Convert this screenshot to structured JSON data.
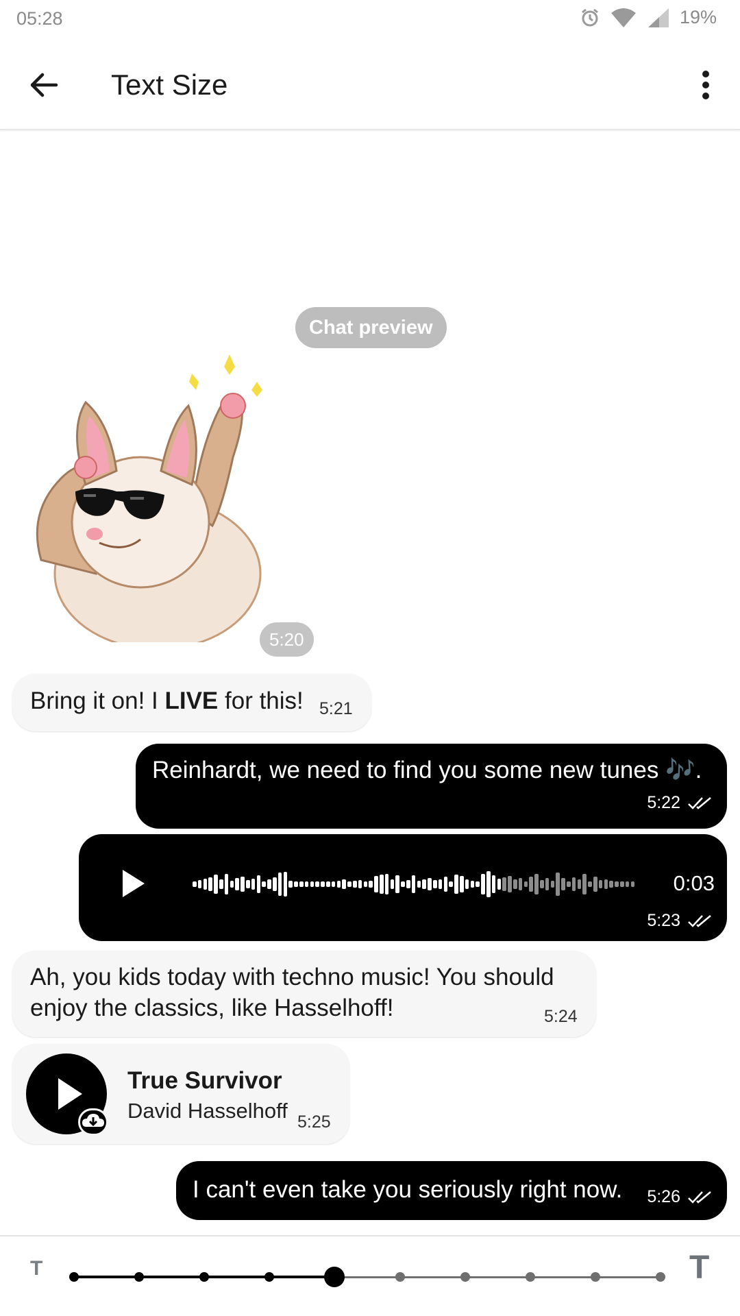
{
  "status_bar": {
    "time": "05:28",
    "battery": "19%"
  },
  "app_bar": {
    "title": "Text Size"
  },
  "chat": {
    "preview_label": "Chat preview",
    "sticker_time": "5:20",
    "messages": [
      {
        "text_before": "Bring it on! I ",
        "text_bold": "LIVE",
        "text_after": " for this!",
        "time": "5:21"
      },
      {
        "text": "Reinhardt, we need to find you some new tunes 🎶.",
        "time": "5:22"
      },
      {
        "voice_duration": "0:03",
        "time": "5:23"
      },
      {
        "text": "Ah, you kids today with techno music! You should enjoy the classics, like Hasselhoff!",
        "time": "5:24"
      },
      {
        "song_title": "True Survivor",
        "song_artist": "David Hasselhoff",
        "time": "5:25"
      },
      {
        "text": "I can't even take you seriously right now.",
        "time": "5:26"
      }
    ]
  },
  "text_size_slider": {
    "small_label": "T",
    "large_label": "T",
    "steps": 10,
    "selected_step": 4
  },
  "colors": {
    "accent": "#000000",
    "incoming_bubble": "#f6f6f6",
    "outgoing_bubble": "#000000"
  }
}
